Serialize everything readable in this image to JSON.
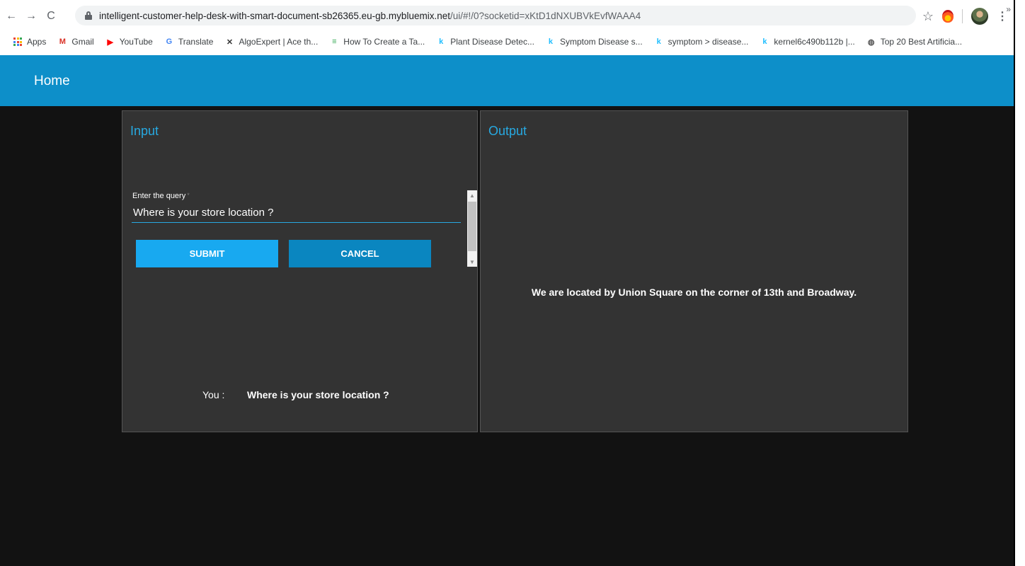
{
  "browser": {
    "url_host": "intelligent-customer-help-desk-with-smart-document-sb26365.eu-gb.mybluemix.net",
    "url_path": "/ui/#!/0?socketid=xKtD1dNXUBVkEvfWAAA4",
    "nav": {
      "back": "←",
      "forward": "→",
      "reload": "C"
    },
    "star": "☆",
    "kebab": "⋮",
    "bookmarks": [
      {
        "label": "Apps",
        "icon": "apps-grid-icon"
      },
      {
        "label": "Gmail",
        "icon": "gmail-icon",
        "glyph": "M",
        "color": "#d93025"
      },
      {
        "label": "YouTube",
        "icon": "youtube-icon",
        "glyph": "▶",
        "color": "#ff0000"
      },
      {
        "label": "Translate",
        "icon": "translate-icon",
        "glyph": "G",
        "color": "#4285f4"
      },
      {
        "label": "AlgoExpert | Ace th...",
        "icon": "algoexpert-icon",
        "glyph": "✕",
        "color": "#333333"
      },
      {
        "label": "How To Create a Ta...",
        "icon": "page-icon",
        "glyph": "≡",
        "color": "#34a853"
      },
      {
        "label": "Plant Disease Detec...",
        "icon": "kaggle-icon",
        "glyph": "k",
        "color": "#20beff"
      },
      {
        "label": "Symptom Disease s...",
        "icon": "kaggle-icon",
        "glyph": "k",
        "color": "#20beff"
      },
      {
        "label": "symptom > disease...",
        "icon": "kaggle-icon",
        "glyph": "k",
        "color": "#20beff"
      },
      {
        "label": "kernel6c490b112b |...",
        "icon": "kaggle-icon",
        "glyph": "k",
        "color": "#20beff"
      },
      {
        "label": "Top 20 Best Artificia...",
        "icon": "site-icon",
        "glyph": "◍",
        "color": "#555555"
      }
    ],
    "bookmarks_more": "»"
  },
  "header": {
    "title": "Home"
  },
  "input_panel": {
    "heading": "Input",
    "field_label": "Enter the query",
    "required_mark": "*",
    "query_value": "Where is your store location ?",
    "submit_label": "SUBMIT",
    "cancel_label": "CANCEL",
    "chat_speaker": "You :",
    "chat_message": "Where is your store location ?"
  },
  "output_panel": {
    "heading": "Output",
    "answer": "We are located by Union Square on the corner of 13th and Broadway."
  },
  "colors": {
    "accent": "#27a9e1",
    "app_bar": "#0d8fc9",
    "submit": "#18a9f0",
    "cancel": "#0a86c0",
    "panel_bg": "#333333",
    "page_bg": "#121212"
  }
}
